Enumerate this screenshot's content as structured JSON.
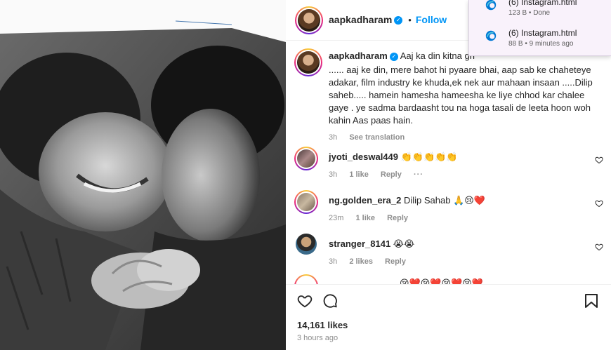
{
  "post": {
    "username": "aapkadharam",
    "follow_label": "Follow",
    "caption_lead": "Aaj ka din kitna gh",
    "caption_body": "...... aaj ke din, mere bahot hi pyaare bhai, aap sab ke chaheteye adakar, film industry ke khuda,ek nek aur mahaan insaan .....Dilip saheb..... hamein hamesha hameesha ke liye chhod kar chalee gaye . ye sadma bardaasht tou na hoga tasali de leeta hoon woh kahin Aas paas hain.",
    "caption_time": "3h",
    "see_translation": "See translation",
    "likes": "14,161 likes",
    "posted_ago": "3 hours ago"
  },
  "comments": [
    {
      "username": "jyoti_deswal449",
      "text": "👏👏👏👏👏",
      "time": "3h",
      "likes": "1 like",
      "reply": "Reply",
      "more": "···"
    },
    {
      "username": "ng.golden_era_2",
      "text": "Dilip Sahab 🙏😢❤️",
      "time": "23m",
      "likes": "1 like",
      "reply": "Reply"
    },
    {
      "username": "stranger_8141",
      "text": "😭😭",
      "time": "3h",
      "likes": "2 likes",
      "reply": "Reply"
    },
    {
      "username": "",
      "text": "😢❤️😢❤️😢❤️😢❤️",
      "time": "",
      "likes": "",
      "reply": ""
    }
  ],
  "downloads": [
    {
      "name": "(6) Instagram.html",
      "status": "123 B • Done"
    },
    {
      "name": "(6) Instagram.html",
      "status": "88 B • 9 minutes ago"
    }
  ],
  "colors": {
    "accent": "#0095f6",
    "heart": "#ed4956",
    "edge_blue": "#0078d4"
  }
}
